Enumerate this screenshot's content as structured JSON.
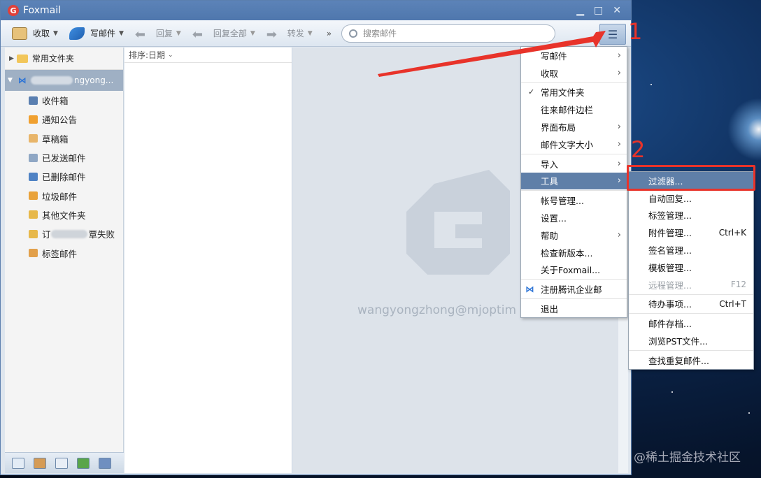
{
  "window": {
    "title": "Foxmail"
  },
  "window_controls": [
    "▁",
    "□",
    "✕"
  ],
  "toolbar": {
    "receive": "收取",
    "compose": "写邮件",
    "reply": "回复",
    "reply_all": "回复全部",
    "forward": "转发",
    "more": "»",
    "search_placeholder": "搜索邮件"
  },
  "sidebar": {
    "favorites": "常用文件夹",
    "account_suffix": "ngyong...",
    "folders": [
      {
        "label": "收件箱",
        "color": "#5a7fb0"
      },
      {
        "label": "通知公告",
        "color": "#f0a030"
      },
      {
        "label": "草稿箱",
        "color": "#e8b56a"
      },
      {
        "label": "已发送邮件",
        "color": "#8fa7c4"
      },
      {
        "label": "已删除邮件",
        "color": "#4f82c4"
      },
      {
        "label": "垃圾邮件",
        "color": "#e9a23a"
      },
      {
        "label": "其他文件夹",
        "color": "#e7b84a"
      },
      {
        "label_prefix": "订",
        "label_suffix": "覃失败",
        "color": "#e7b84a"
      },
      {
        "label": "标签邮件",
        "color": "#e2a04a"
      }
    ]
  },
  "maillist": {
    "sort_label": "排序:日期"
  },
  "reader": {
    "account_email": "wangyongzhong@mjoptim"
  },
  "main_menu": {
    "items": [
      {
        "label": "写邮件",
        "submenu": true
      },
      {
        "label": "收取",
        "submenu": true
      },
      {
        "sep": true
      },
      {
        "label": "常用文件夹",
        "checked": true
      },
      {
        "label": "往来邮件边栏"
      },
      {
        "label": "界面布局",
        "submenu": true
      },
      {
        "label": "邮件文字大小",
        "submenu": true
      },
      {
        "sep": true
      },
      {
        "label": "导入",
        "submenu": true
      },
      {
        "label": "工具",
        "submenu": true,
        "active": true
      },
      {
        "sep": true
      },
      {
        "label": "帐号管理..."
      },
      {
        "label": "设置..."
      },
      {
        "label": "帮助",
        "submenu": true
      },
      {
        "label": "检查新版本..."
      },
      {
        "label": "关于Foxmail..."
      },
      {
        "sep": true
      },
      {
        "label": "注册腾讯企业邮",
        "icon": "foxmail-icon"
      },
      {
        "sep": true
      },
      {
        "label": "退出"
      }
    ]
  },
  "tools_menu": {
    "items": [
      {
        "label": "过滤器...",
        "active": true
      },
      {
        "label": "自动回复..."
      },
      {
        "label": "标签管理..."
      },
      {
        "label": "附件管理...",
        "shortcut": "Ctrl+K"
      },
      {
        "label": "签名管理..."
      },
      {
        "label": "模板管理..."
      },
      {
        "label": "远程管理...",
        "shortcut": "F12",
        "disabled": true
      },
      {
        "sep": true
      },
      {
        "label": "待办事项...",
        "shortcut": "Ctrl+T"
      },
      {
        "sep": true
      },
      {
        "label": "邮件存档..."
      },
      {
        "label": "浏览PST文件..."
      },
      {
        "sep": true
      },
      {
        "label": "查找重复邮件..."
      }
    ]
  },
  "annotations": {
    "step1": "1",
    "step2": "2",
    "color": "#e8332a"
  },
  "watermark": "@稀土掘金技术社区"
}
